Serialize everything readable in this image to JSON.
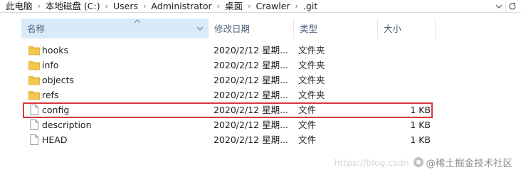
{
  "breadcrumb": [
    "此电脑",
    "本地磁盘 (C:)",
    "Users",
    "Administrator",
    "桌面",
    "Crawler",
    ".git"
  ],
  "columns": {
    "name": "名称",
    "date": "修改日期",
    "type": "类型",
    "size": "大小"
  },
  "files": [
    {
      "name": "hooks",
      "date": "2020/2/12 星期...",
      "type": "文件夹",
      "size": "",
      "icon": "folder-icon"
    },
    {
      "name": "info",
      "date": "2020/2/12 星期...",
      "type": "文件夹",
      "size": "",
      "icon": "folder-icon"
    },
    {
      "name": "objects",
      "date": "2020/2/12 星期...",
      "type": "文件夹",
      "size": "",
      "icon": "folder-icon"
    },
    {
      "name": "refs",
      "date": "2020/2/12 星期...",
      "type": "文件夹",
      "size": "",
      "icon": "folder-icon"
    },
    {
      "name": "config",
      "date": "2020/2/12 星期...",
      "type": "文件",
      "size": "1 KB",
      "icon": "file-icon",
      "highlighted": true
    },
    {
      "name": "description",
      "date": "2020/2/12 星期...",
      "type": "文件",
      "size": "1 KB",
      "icon": "file-icon"
    },
    {
      "name": "HEAD",
      "date": "2020/2/12 星期...",
      "type": "文件",
      "size": "1 KB",
      "icon": "file-icon"
    }
  ],
  "watermark": {
    "url": "https://blog.csdn",
    "brand": "@稀土掘金技术社区"
  },
  "colors": {
    "header_selected_bg": "#d9ebf9",
    "folder": "#f4c84d",
    "highlight_border": "#d9363e"
  }
}
